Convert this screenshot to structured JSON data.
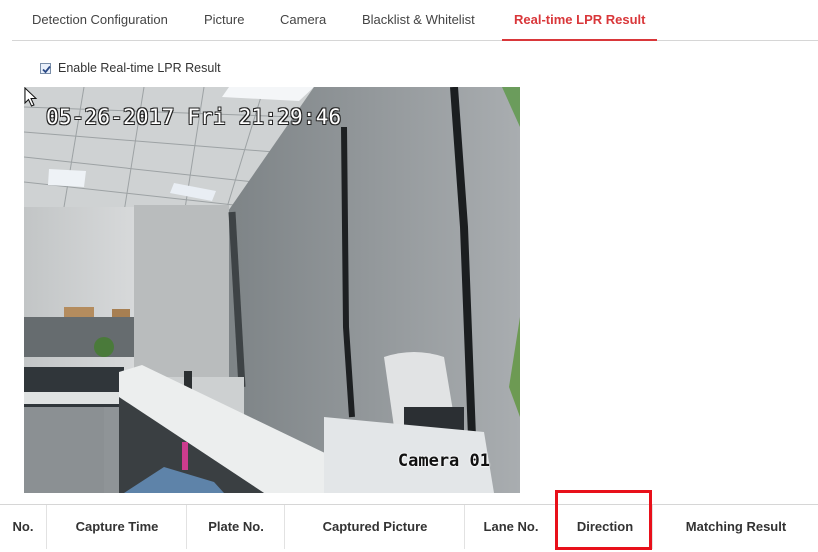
{
  "tabs": [
    {
      "label": "Detection Configuration",
      "active": false
    },
    {
      "label": "Picture",
      "active": false
    },
    {
      "label": "Camera",
      "active": false
    },
    {
      "label": "Blacklist & Whitelist",
      "active": false
    },
    {
      "label": "Real-time LPR Result",
      "active": true
    }
  ],
  "enable": {
    "label": "Enable Real-time LPR Result",
    "checked": true
  },
  "video": {
    "timestamp": "05-26-2017 Fri 21:29:46",
    "camera_name": "Camera 01"
  },
  "table": {
    "columns": [
      "No.",
      "Capture Time",
      "Plate No.",
      "Captured Picture",
      "Lane No.",
      "Direction",
      "Matching Result"
    ],
    "highlighted_column": "Direction"
  },
  "colors": {
    "accent": "#d9373a",
    "highlight_box": "#e8101a"
  }
}
